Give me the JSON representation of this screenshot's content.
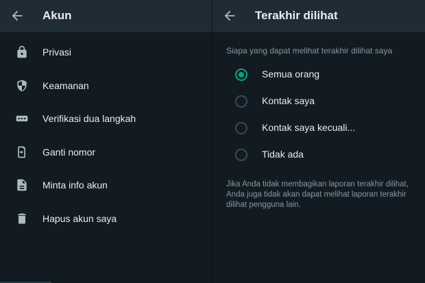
{
  "left": {
    "title": "Akun",
    "items": [
      {
        "label": "Privasi",
        "icon": "lock-icon"
      },
      {
        "label": "Keamanan",
        "icon": "shield-icon"
      },
      {
        "label": "Verifikasi dua langkah",
        "icon": "password-dots-icon"
      },
      {
        "label": "Ganti nomor",
        "icon": "change-number-icon"
      },
      {
        "label": "Minta info akun",
        "icon": "document-icon"
      },
      {
        "label": "Hapus akun saya",
        "icon": "trash-icon"
      }
    ]
  },
  "right": {
    "title": "Terakhir dilihat",
    "subtitle": "Siapa yang dapat melihat terakhir dilihat saya",
    "options": [
      {
        "label": "Semua orang",
        "selected": true
      },
      {
        "label": "Kontak saya",
        "selected": false
      },
      {
        "label": "Kontak saya kecuali...",
        "selected": false
      },
      {
        "label": "Tidak ada",
        "selected": false
      }
    ],
    "note": "Jika Anda tidak membagikan laporan terakhir dilihat, Anda juga tidak akan dapat melihat laporan terakhir dilihat pengguna lain."
  },
  "colors": {
    "background": "#111b21",
    "appbar": "#1f2c34",
    "accent": "#00a884",
    "text_primary": "#e9edef",
    "text_secondary": "#8696a0"
  }
}
